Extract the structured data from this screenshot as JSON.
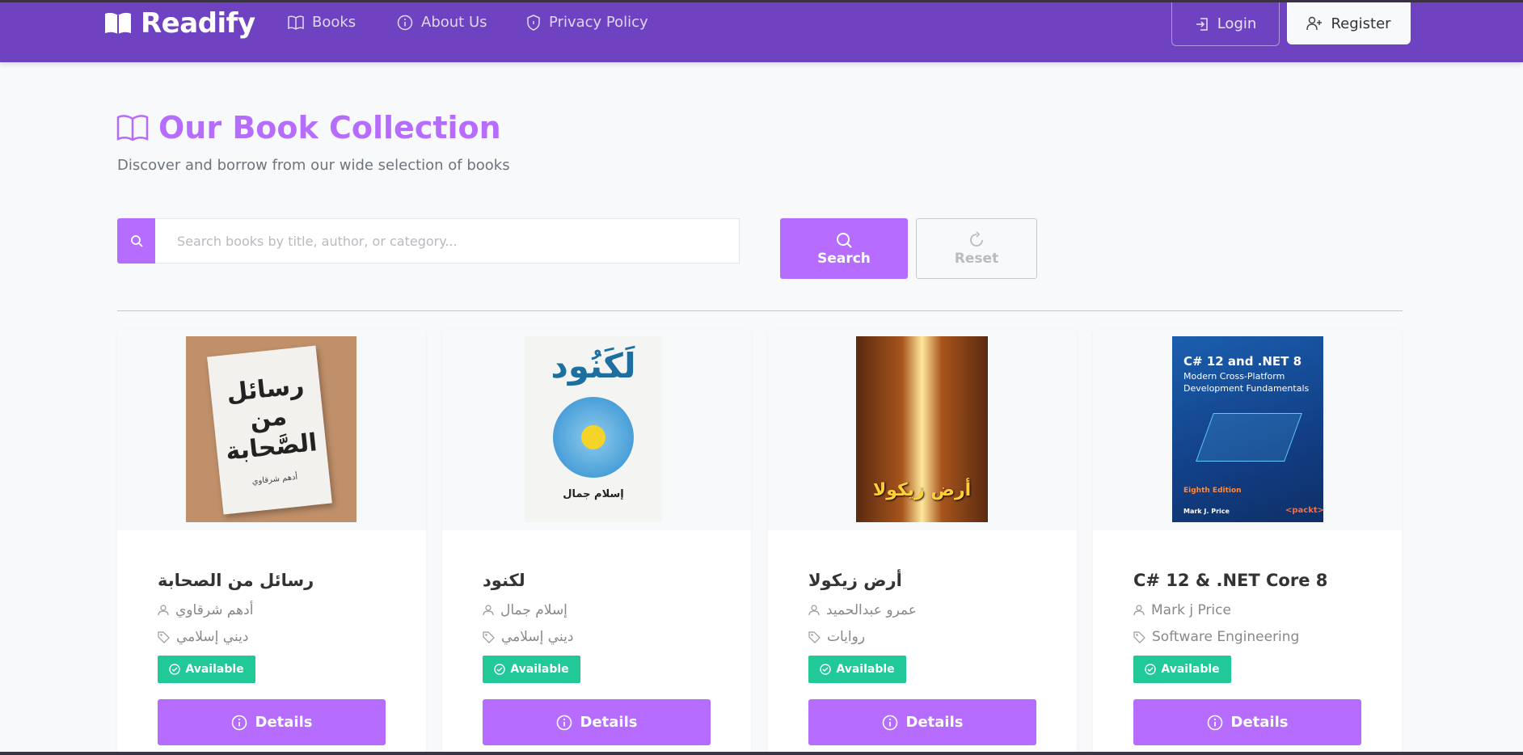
{
  "brand": {
    "name": "Readify",
    "icon": "book-icon"
  },
  "nav": {
    "links": [
      {
        "label": "Books",
        "icon": "book-open-icon"
      },
      {
        "label": "About Us",
        "icon": "info-icon"
      },
      {
        "label": "Privacy Policy",
        "icon": "shield-icon"
      }
    ],
    "login_label": "Login",
    "register_label": "Register"
  },
  "colors": {
    "navbar": "#6f42c1",
    "accent": "#b66dff",
    "available": "#20c997"
  },
  "page": {
    "title": "Our Book Collection",
    "subtitle": "Discover and borrow from our wide selection of books"
  },
  "search": {
    "placeholder": "Search books by title, author, or category...",
    "value": "",
    "search_label": "Search",
    "reset_label": "Reset"
  },
  "books": [
    {
      "title": "رسائل من الصحابة",
      "author": "أدهم شرقاوي",
      "category": "ديني إسلامي",
      "status": "Available",
      "details_label": "Details",
      "cover_text": [
        "رسائل",
        "من",
        "الصَّحابة"
      ],
      "cover_author": "أدهم شرقاوي"
    },
    {
      "title": "لكنود",
      "author": "إسلام جمال",
      "category": "ديني إسلامي",
      "status": "Available",
      "details_label": "Details",
      "cover_text": [
        "لَكَنُود"
      ],
      "cover_author": "إسلام جمال"
    },
    {
      "title": "أرض زيكولا",
      "author": "عمرو عبدالحميد",
      "category": "روايات",
      "status": "Available",
      "details_label": "Details",
      "cover_text": [
        "أرض زيكولا"
      ],
      "cover_author": ""
    },
    {
      "title": "C# 12 & .NET Core 8",
      "author": "Mark j Price",
      "category": "Software Engineering",
      "status": "Available",
      "details_label": "Details",
      "cover_text": [
        "C# 12 and .NET 8",
        "Modern Cross-Platform",
        "Development Fundamentals"
      ],
      "cover_edition": "Eighth Edition",
      "cover_author": "Mark J. Price",
      "cover_publisher": "<packt>"
    }
  ]
}
